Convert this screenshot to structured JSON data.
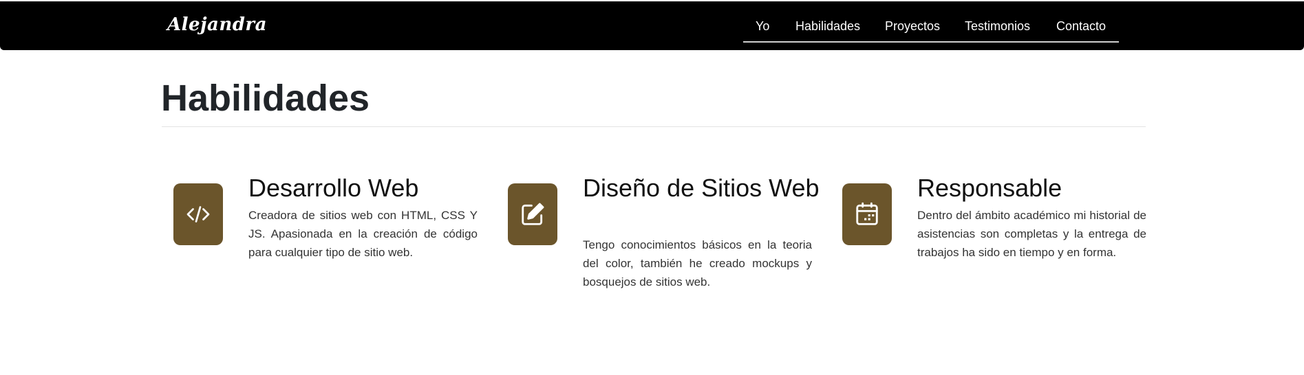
{
  "navbar": {
    "brand": "Alejandra",
    "links": [
      "Yo",
      "Habilidades",
      "Proyectos",
      "Testimonios",
      "Contacto"
    ]
  },
  "section": {
    "title": "Habilidades"
  },
  "features": [
    {
      "icon": "code-icon",
      "title": "Desarrollo Web",
      "text": "Creadora de sitios web con HTML, CSS Y JS. Apasionada en la creación de código para cualquier tipo de sitio web."
    },
    {
      "icon": "edit-icon",
      "title": "Diseño de Sitios Web",
      "text": "Tengo conocimientos básicos en la teoria del color, también he creado mockups y bosquejos de sitios web."
    },
    {
      "icon": "calendar-icon",
      "title": "Responsable",
      "text": "Dentro del ámbito académico mi historial de asistencias son completas y la entrega de trabajos ha sido en tiempo y en forma."
    }
  ],
  "colors": {
    "navbar": "#000000",
    "icon_background": "#6b552b",
    "heading": "#212529"
  }
}
